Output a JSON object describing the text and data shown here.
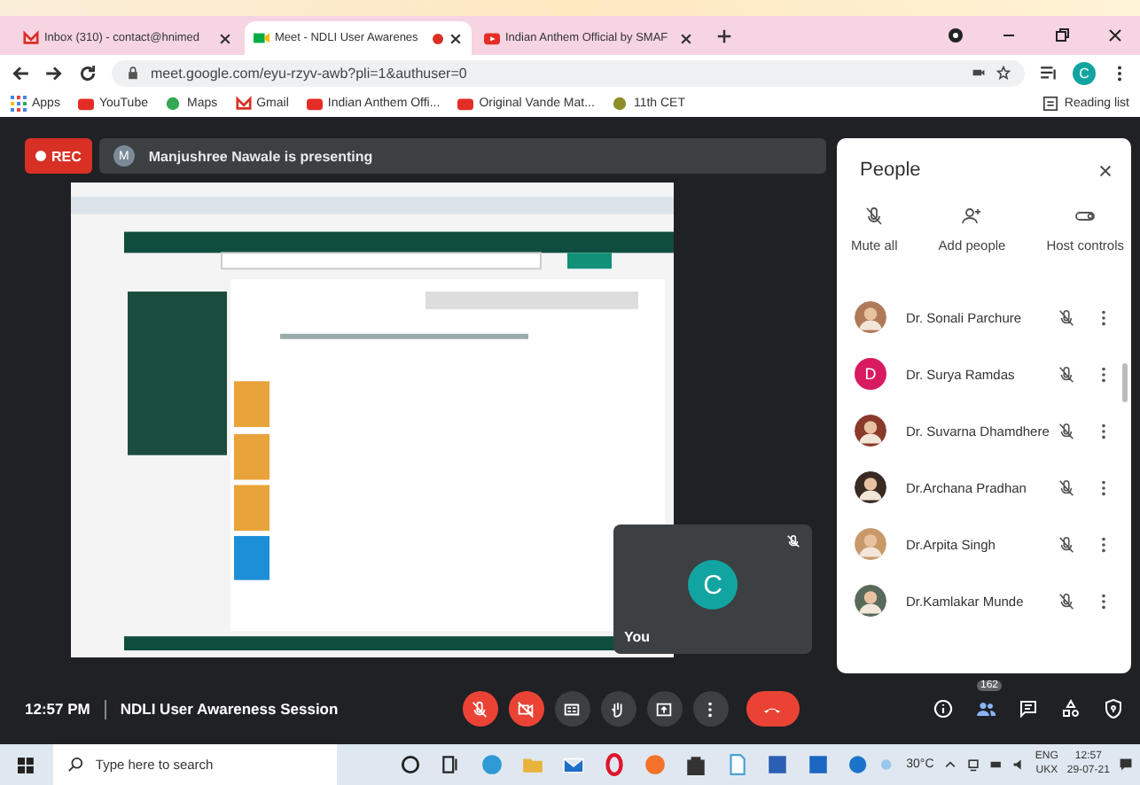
{
  "browser": {
    "tabs": [
      {
        "title": "Inbox (310) - contact@hnimed",
        "selected": false
      },
      {
        "title": "Meet - NDLI User Awarenes",
        "selected": true,
        "recording": true
      },
      {
        "title": "Indian Anthem Official by SMAF",
        "selected": false
      }
    ],
    "url": "meet.google.com/eyu-rzyv-awb?pli=1&authuser=0",
    "profile_initial": "C",
    "bookmarks": [
      {
        "label": "Apps"
      },
      {
        "label": "YouTube"
      },
      {
        "label": "Maps"
      },
      {
        "label": "Gmail"
      },
      {
        "label": "Indian Anthem Offi..."
      },
      {
        "label": "Original Vande Mat..."
      },
      {
        "label": "11th CET"
      }
    ],
    "reading_list": "Reading list"
  },
  "meet": {
    "rec": "REC",
    "presenter": {
      "initial": "M",
      "text": "Manjushree Nawale is presenting"
    },
    "self_tile": {
      "initial": "C",
      "label": "You"
    },
    "people": {
      "title": "People",
      "actions": [
        {
          "label": "Mute all"
        },
        {
          "label": "Add people"
        },
        {
          "label": "Host controls"
        }
      ],
      "participants": [
        {
          "name": "Dr. Sonali Parchure",
          "color": "#b07a5a"
        },
        {
          "name": "Dr. Surya Ramdas",
          "initial": "D",
          "color": "#d81b60"
        },
        {
          "name": "Dr. Suvarna Dhamdhere",
          "color": "#8a3a2a"
        },
        {
          "name": "Dr.Archana Pradhan",
          "color": "#3a2a24"
        },
        {
          "name": "Dr.Arpita Singh",
          "color": "#c89a6a"
        },
        {
          "name": "Dr.Kamlakar Munde",
          "color": "#5a6a5a"
        }
      ]
    },
    "time": "12:57 PM",
    "meeting_title": "NDLI User Awareness Session",
    "controls": [
      {
        "kind": "mic_off"
      },
      {
        "kind": "cam_off"
      },
      {
        "kind": "captions"
      },
      {
        "kind": "hand"
      },
      {
        "kind": "present"
      },
      {
        "kind": "more"
      },
      {
        "kind": "hangup"
      }
    ],
    "side_controls": [
      {
        "kind": "info"
      },
      {
        "kind": "people",
        "badge": "162"
      },
      {
        "kind": "chat"
      },
      {
        "kind": "activities"
      },
      {
        "kind": "safety"
      }
    ]
  },
  "taskbar": {
    "search_placeholder": "Type here to search",
    "apps": [
      {
        "kind": "cortana"
      },
      {
        "kind": "taskview"
      },
      {
        "kind": "edge"
      },
      {
        "kind": "folder"
      },
      {
        "kind": "mail"
      },
      {
        "kind": "opera"
      },
      {
        "kind": "firefox"
      },
      {
        "kind": "store"
      },
      {
        "kind": "doc"
      },
      {
        "kind": "word"
      },
      {
        "kind": "outlook"
      }
    ],
    "temperature": "30°C",
    "language": "ENG",
    "keyboard": "UKX",
    "clock": "12:57",
    "date": "29-07-21"
  }
}
